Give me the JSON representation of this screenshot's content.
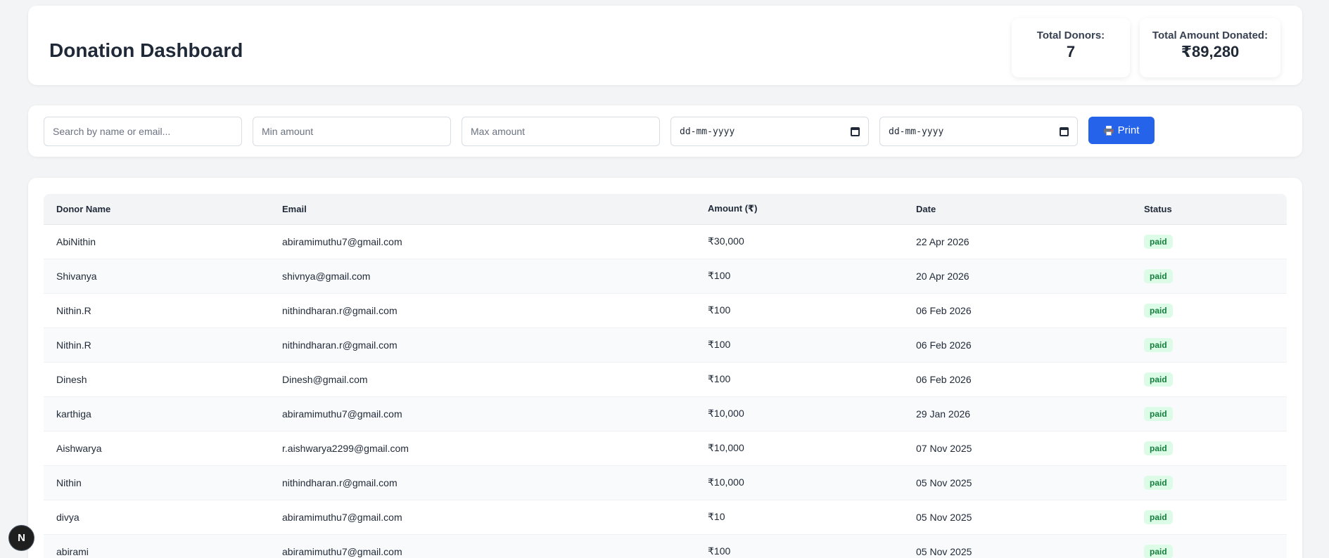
{
  "header": {
    "title": "Donation Dashboard",
    "total_donors_label": "Total Donors:",
    "total_donors_value": "7",
    "total_amount_label": "Total Amount Donated:",
    "total_amount_value": "₹89,280"
  },
  "filters": {
    "search_placeholder": "Search by name or email...",
    "min_placeholder": "Min amount",
    "max_placeholder": "Max amount",
    "from_date_value": "dd-mm-yyyy",
    "to_date_value": "dd-mm-yyyy",
    "print_label": "Print"
  },
  "table": {
    "columns": [
      "Donor Name",
      "Email",
      "Amount (₹)",
      "Date",
      "Status"
    ],
    "rows": [
      {
        "name": "AbiNithin",
        "email": "abiramimuthu7@gmail.com",
        "amount": "₹30,000",
        "date": "22 Apr 2026",
        "status": "paid"
      },
      {
        "name": "Shivanya",
        "email": "shivnya@gmail.com",
        "amount": "₹100",
        "date": "20 Apr 2026",
        "status": "paid"
      },
      {
        "name": "Nithin.R",
        "email": "nithindharan.r@gmail.com",
        "amount": "₹100",
        "date": "06 Feb 2026",
        "status": "paid"
      },
      {
        "name": "Nithin.R",
        "email": "nithindharan.r@gmail.com",
        "amount": "₹100",
        "date": "06 Feb 2026",
        "status": "paid"
      },
      {
        "name": "Dinesh",
        "email": "Dinesh@gmail.com",
        "amount": "₹100",
        "date": "06 Feb 2026",
        "status": "paid"
      },
      {
        "name": "karthiga",
        "email": "abiramimuthu7@gmail.com",
        "amount": "₹10,000",
        "date": "29 Jan 2026",
        "status": "paid"
      },
      {
        "name": "Aishwarya",
        "email": "r.aishwarya2299@gmail.com",
        "amount": "₹10,000",
        "date": "07 Nov 2025",
        "status": "paid"
      },
      {
        "name": "Nithin",
        "email": "nithindharan.r@gmail.com",
        "amount": "₹10,000",
        "date": "05 Nov 2025",
        "status": "paid"
      },
      {
        "name": "divya",
        "email": "abiramimuthu7@gmail.com",
        "amount": "₹10",
        "date": "05 Nov 2025",
        "status": "paid"
      },
      {
        "name": "abirami",
        "email": "abiramimuthu7@gmail.com",
        "amount": "₹100",
        "date": "05 Nov 2025",
        "status": "paid"
      }
    ]
  },
  "dev_badge": {
    "letter": "N"
  },
  "icons": {
    "print": "printer-icon",
    "calendar": "calendar-icon"
  },
  "colors": {
    "accent": "#2563eb",
    "paid_badge_bg": "#dcfce7",
    "paid_badge_text": "#15803d"
  }
}
